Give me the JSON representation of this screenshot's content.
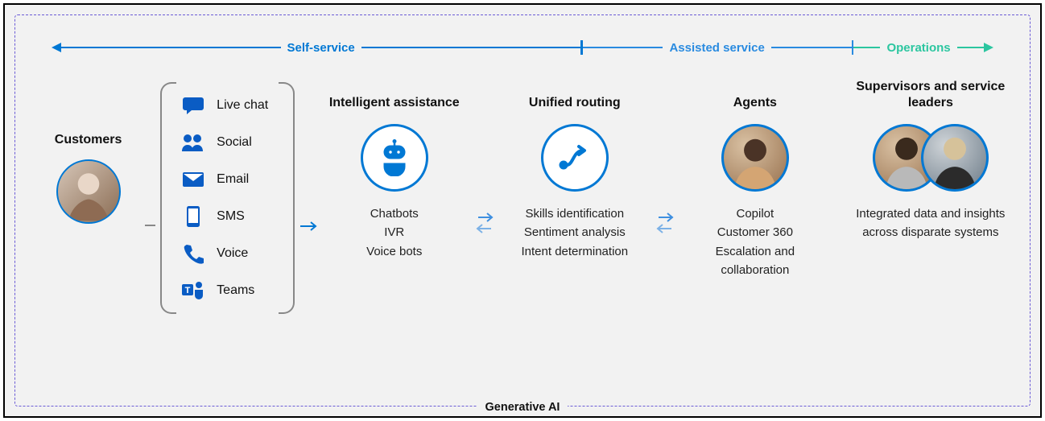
{
  "timeline": {
    "self_service": "Self-service",
    "assisted_service": "Assisted service",
    "operations": "Operations"
  },
  "customers": {
    "title": "Customers"
  },
  "channels": [
    {
      "icon": "chat-icon",
      "label": "Live chat"
    },
    {
      "icon": "social-icon",
      "label": "Social"
    },
    {
      "icon": "email-icon",
      "label": "Email"
    },
    {
      "icon": "sms-icon",
      "label": "SMS"
    },
    {
      "icon": "voice-icon",
      "label": "Voice"
    },
    {
      "icon": "teams-icon",
      "label": "Teams"
    }
  ],
  "intelligent_assistance": {
    "title": "Intelligent assistance",
    "items": [
      "Chatbots",
      "IVR",
      "Voice bots"
    ]
  },
  "unified_routing": {
    "title": "Unified routing",
    "items": [
      "Skills identification",
      "Sentiment analysis",
      "Intent determination"
    ]
  },
  "agents": {
    "title": "Agents",
    "items": [
      "Copilot",
      "Customer 360",
      "Escalation and collaboration"
    ]
  },
  "supervisors": {
    "title": "Supervisors and service leaders",
    "items": [
      "Integrated data and insights across disparate systems"
    ]
  },
  "footer": "Generative AI"
}
